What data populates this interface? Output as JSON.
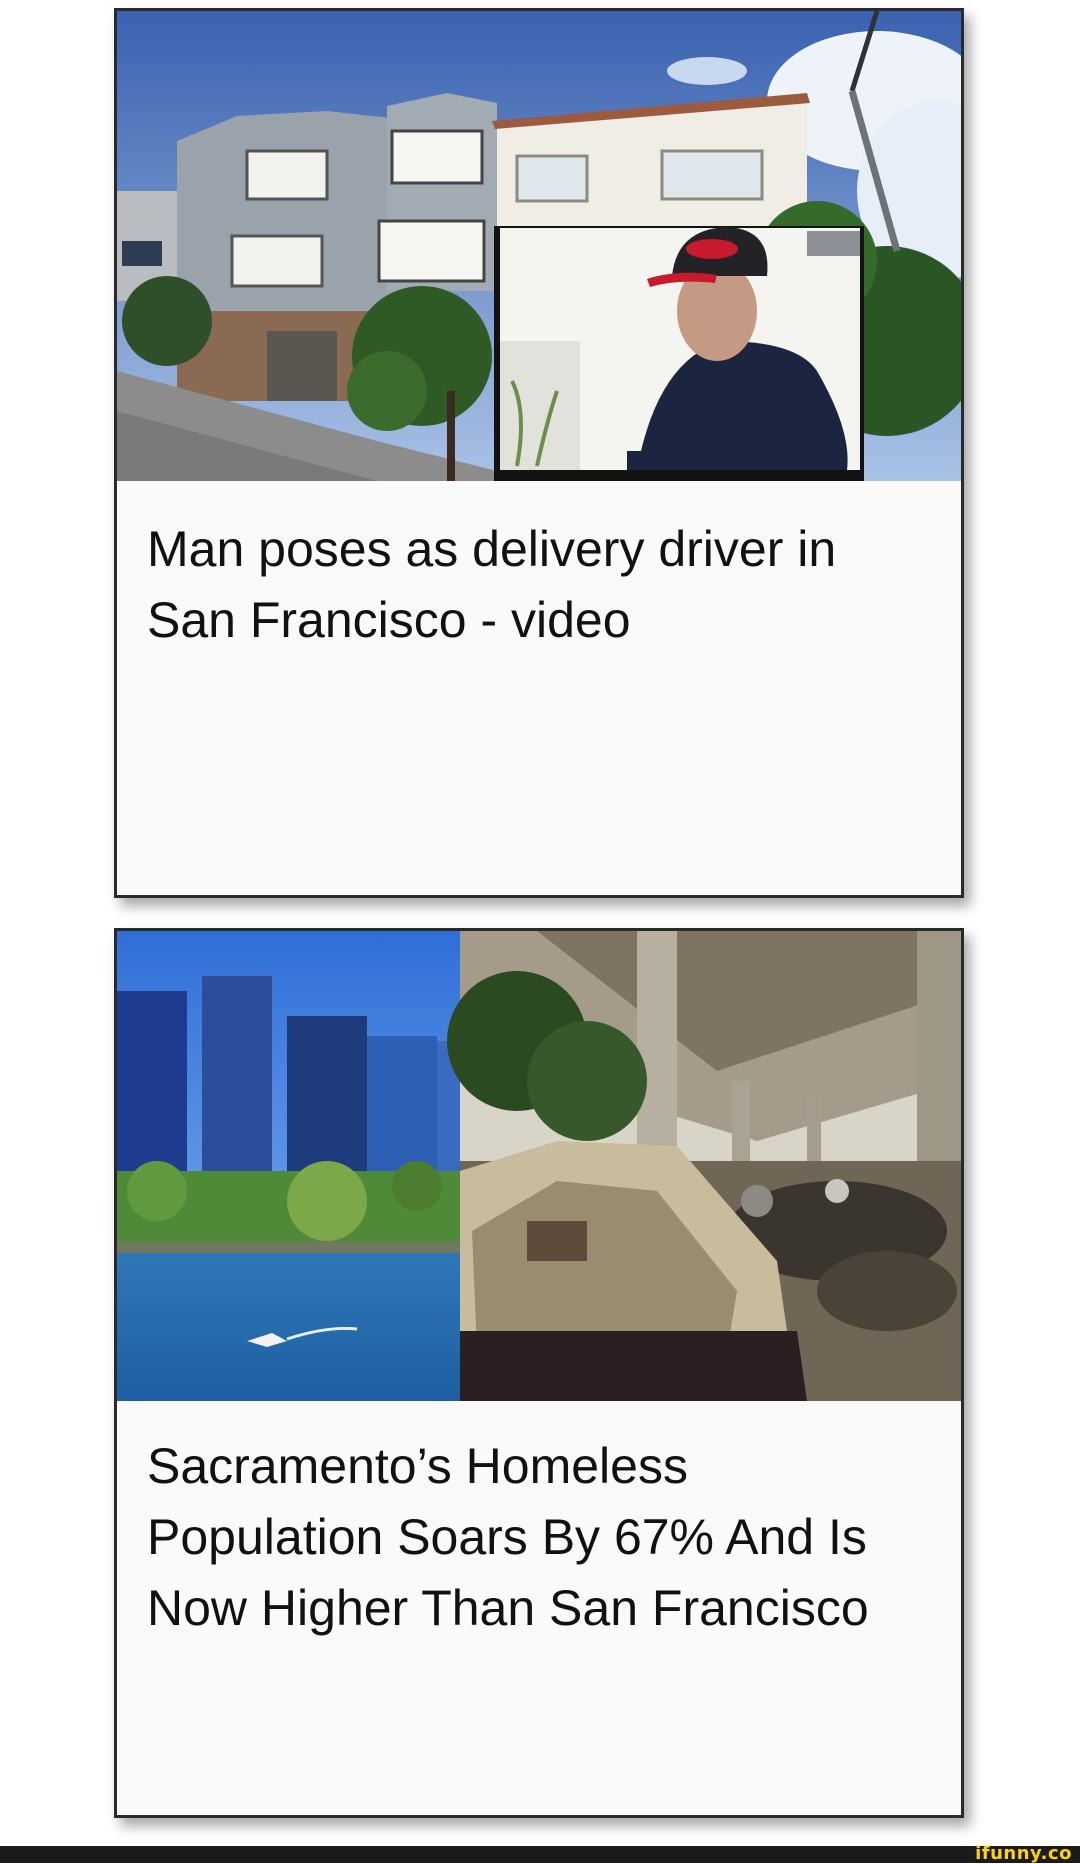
{
  "articles": [
    {
      "headline": "Man poses as delivery driver in San Francisco - video"
    },
    {
      "headline": "Sacramento’s Homeless Population Soars By 67% And Is Now Higher Than San Francisco"
    }
  ],
  "watermark": {
    "text": "ifunny.co"
  }
}
